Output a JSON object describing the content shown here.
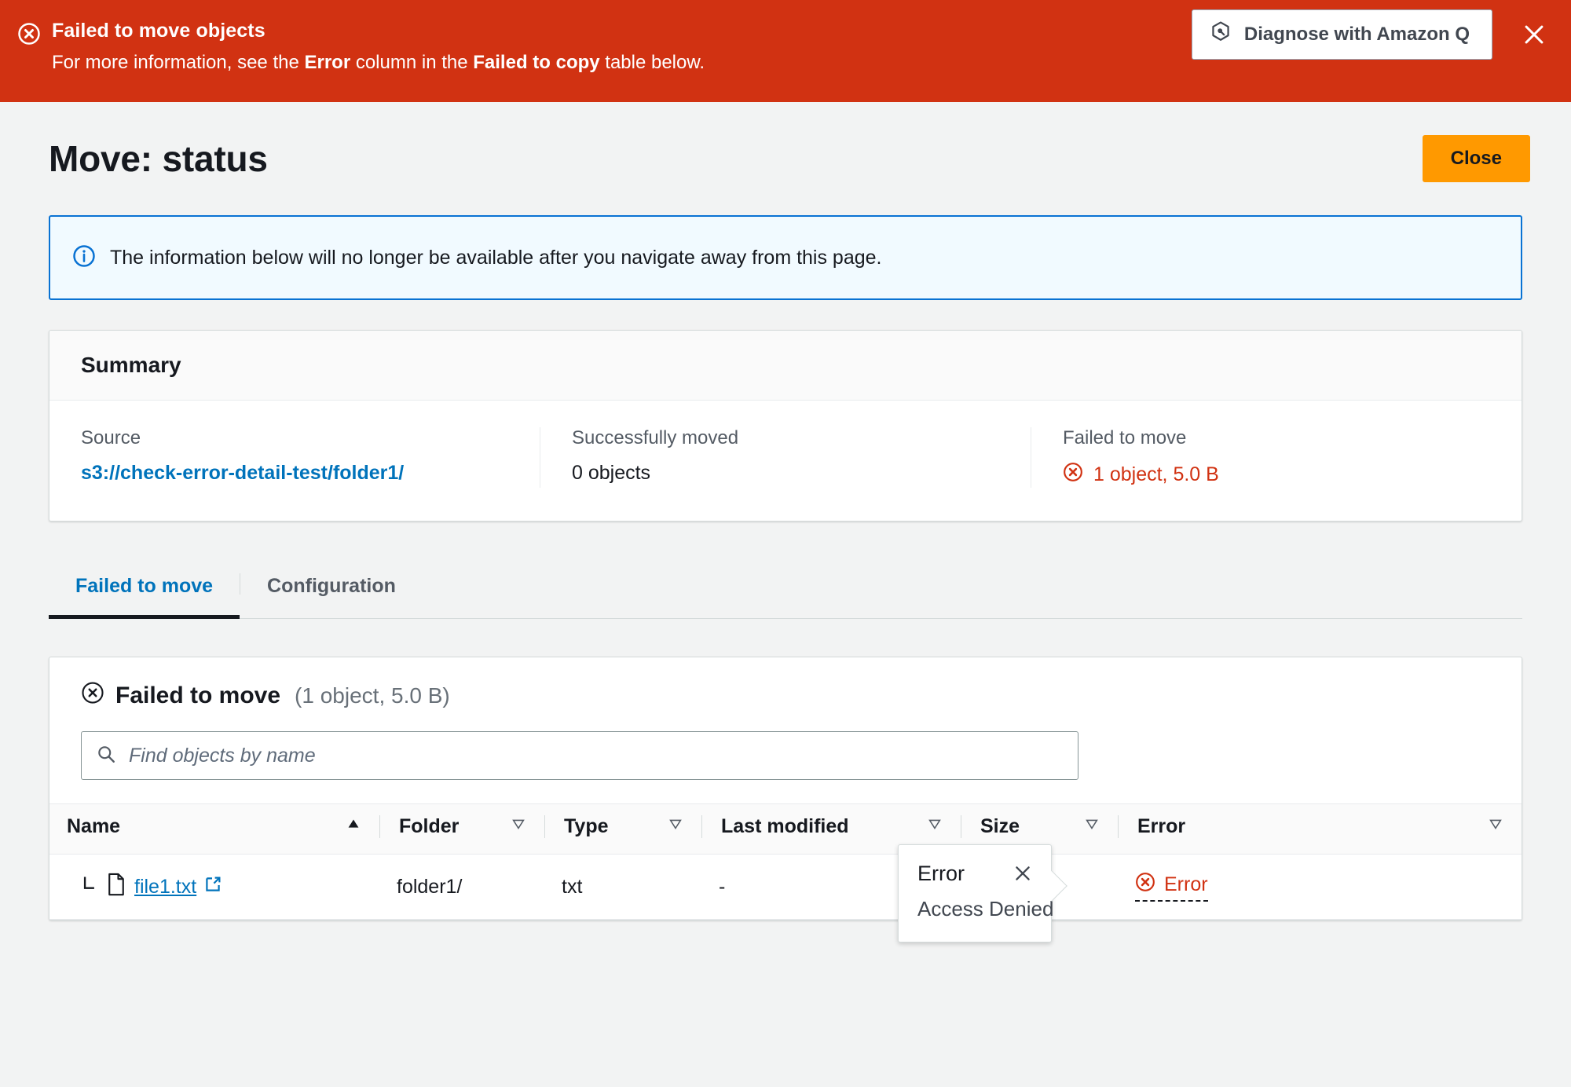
{
  "banner": {
    "icon": "status-error-icon",
    "title": "Failed to move objects",
    "message_pre": "For more information, see the ",
    "message_bold1": "Error",
    "message_mid": " column in the ",
    "message_bold2": "Failed to copy",
    "message_post": " table below.",
    "q_button_label": "Diagnose with Amazon Q",
    "q_button_icon": "amazon-q-icon",
    "dismiss_icon": "close-icon",
    "background_color": "#d13212"
  },
  "header": {
    "title": "Move: status",
    "close_label": "Close",
    "close_color": "#ff9900"
  },
  "info_alert": {
    "icon": "info-icon",
    "text": "The information below will no longer be available after you navigate away from this page.",
    "border_color": "#0972d3",
    "background_color": "#f1faff"
  },
  "summary": {
    "heading": "Summary",
    "columns": [
      {
        "label": "Source",
        "value": "s3://check-error-detail-test/folder1/",
        "type": "link"
      },
      {
        "label": "Successfully moved",
        "value": "0 objects",
        "type": "text"
      },
      {
        "label": "Failed to move",
        "value": "1 object, 5.0 B",
        "type": "error",
        "icon": "status-error-icon",
        "color": "#d13212"
      }
    ]
  },
  "tabs": [
    {
      "label": "Failed to move",
      "active": true
    },
    {
      "label": "Configuration",
      "active": false
    }
  ],
  "table": {
    "icon": "status-error-icon",
    "title": "Failed to move",
    "count": "(1 object, 5.0 B)",
    "search": {
      "placeholder": "Find objects by name",
      "value": "",
      "icon": "search-icon"
    },
    "columns": [
      {
        "label": "Name",
        "sort_icon": "sort-ascending-icon",
        "sorted": true
      },
      {
        "label": "Folder",
        "sort_icon": "sort-icon",
        "sorted": false
      },
      {
        "label": "Type",
        "sort_icon": "sort-icon",
        "sorted": false
      },
      {
        "label": "Last modified",
        "sort_icon": "sort-icon",
        "sorted": false
      },
      {
        "label": "Size",
        "sort_icon": "sort-icon",
        "sorted": false
      },
      {
        "label": "Error",
        "sort_icon": "sort-icon",
        "sorted": false
      }
    ],
    "rows": [
      {
        "name": "file1.txt",
        "name_icon": "file-icon",
        "tree_icon": "tree-branch-icon",
        "external_icon": "external-link-icon",
        "folder": "folder1/",
        "type": "txt",
        "last_modified": "-",
        "size": "",
        "error": "Error",
        "error_icon": "status-error-icon"
      }
    ]
  },
  "popover": {
    "title": "Error",
    "body": "Access Denied",
    "close_icon": "close-icon"
  }
}
